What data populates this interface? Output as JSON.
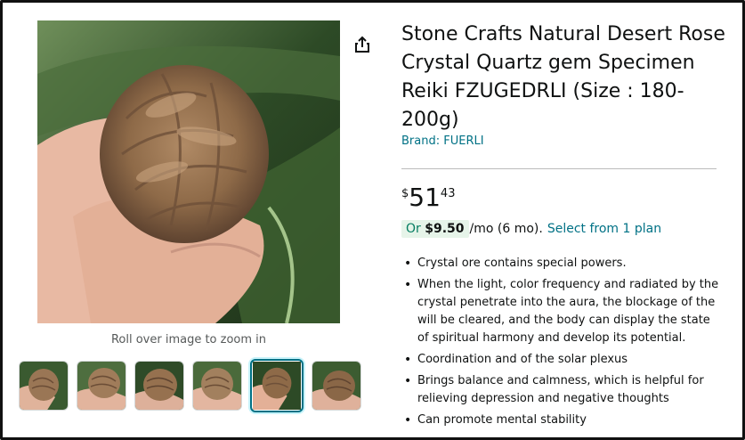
{
  "product": {
    "title": "Stone Crafts Natural Desert Rose Crystal Quartz gem Specimen Reiki FZUGEDRLI (Size : 180-200g)",
    "brand": "Brand: FUERLI"
  },
  "image": {
    "zoom_hint": "Roll over image to zoom in",
    "share_icon": "share-icon",
    "thumbnail_count": 6,
    "selected_thumbnail": 5
  },
  "price": {
    "symbol": "$",
    "whole": "51",
    "fraction": "43"
  },
  "financing": {
    "prefix": "Or ",
    "amount": "$9.50",
    "term": "/mo (6 mo).",
    "plan_link": "Select from 1 plan"
  },
  "bullets": [
    "Crystal ore contains special powers.",
    "When the light, color frequency and radiated by the crystal penetrate into the aura, the blockage of the will be cleared, and the body can display the state of spiritual harmony and develop its potential.",
    "Coordination and of the solar plexus",
    "Brings balance and calmness, which is helpful for relieving depression and negative thoughts",
    "Can promote mental stability"
  ],
  "colors": {
    "link": "#007185",
    "finance_bg": "#e6f4e9",
    "selected_border": "#007185"
  }
}
